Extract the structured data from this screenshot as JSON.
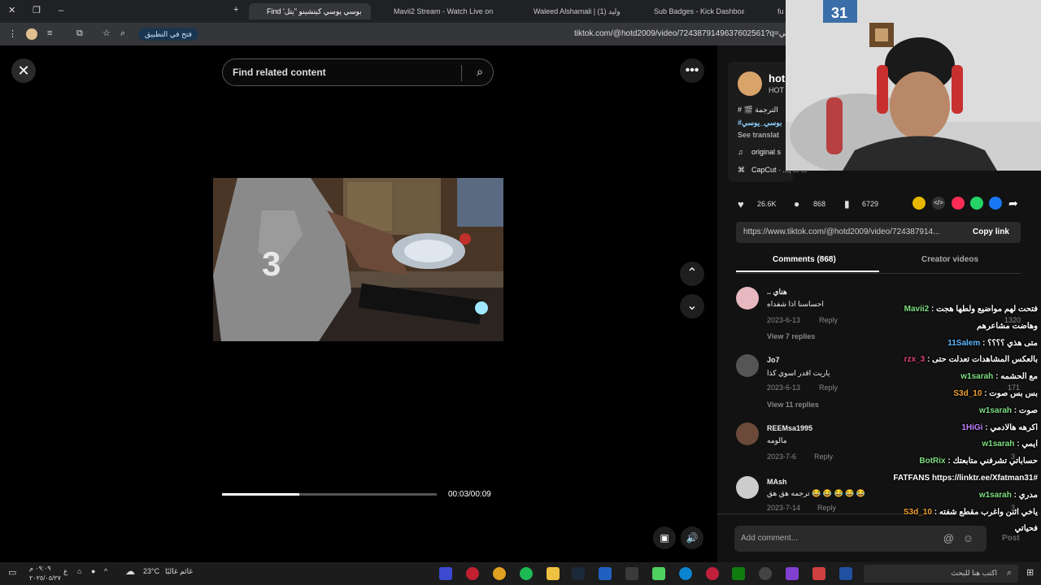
{
  "tabs": [
    {
      "label": "Find 'بوسي يوسي كيتشينو \"يتل"
    },
    {
      "label": "Mavii2 Stream - Watch Live on"
    },
    {
      "label": "Waleed Alshamali | (1) وليد"
    },
    {
      "label": "Sub Badges - Kick Dashboard"
    },
    {
      "label": "fu"
    }
  ],
  "address_bar": {
    "open_in_app": "فتح في التطبيق",
    "url": "tiktok.com/@hotd2009/video/7243879149637602561?q=يوسي"
  },
  "video": {
    "search_placeholder": "Find related content",
    "progress": 0.36,
    "time": "00:03/00:09"
  },
  "creator": {
    "name": "hot",
    "sub": "HOT",
    "caption_line1": "# 🎬 الترجمة",
    "caption_line2": "#بوسي_يوسي",
    "see_translation": "See translat",
    "sound": "original s",
    "capcut": "CapCut · ..., ... ..."
  },
  "stats": {
    "likes": "26.6K",
    "comments": "868",
    "saves": "6729"
  },
  "share": {
    "link": "https://www.tiktok.com/@hotd2009/video/724387914...",
    "copy_label": "Copy link"
  },
  "panel_tabs": {
    "comments": "Comments (868)",
    "creator_videos": "Creator videos"
  },
  "comments": [
    {
      "user": ".. هناي",
      "text": "احساسنا اذا شفداه",
      "date": "2023-6-13",
      "reply": "Reply",
      "replies": "View 7 replies",
      "likes": "1320"
    },
    {
      "user": "Jo7",
      "text": "ياريت اقدر اسوي كذا",
      "date": "2023-6-13",
      "reply": "Reply",
      "replies": "View 11 replies",
      "likes": "171"
    },
    {
      "user": "REEMsa1995",
      "text": "مالومه",
      "date": "2023-7-6",
      "reply": "Reply",
      "likes": "3"
    },
    {
      "user": "MAsh",
      "text": "ترجمه هق هق 😂 😂 😂 😂 😂",
      "date": "2023-7-14",
      "reply": "Reply",
      "likes": "3"
    }
  ],
  "add_comment": {
    "placeholder": "Add comment...",
    "post": "Post"
  },
  "chat": [
    {
      "name": "Mavii2",
      "msg": "فتحت لهم مواضيع ولطها هجت",
      "color": "#7ee081"
    },
    {
      "name": "",
      "msg": "وهاضت مشاعرهم",
      "color": "#fff"
    },
    {
      "name": "11Salem",
      "msg": "متى هذي ؟؟؟؟",
      "color": "#5fb8ff"
    },
    {
      "name": "rzx_3",
      "msg": "بالعكس المشاهدات تعدلت حتى",
      "color": "#e0407a"
    },
    {
      "name": "w1sarah",
      "msg": "مع الحشمه",
      "color": "#7ee081"
    },
    {
      "name": "S3d_10",
      "msg": "بس بس صوت",
      "color": "#f0a030"
    },
    {
      "name": "w1sarah",
      "msg": "صوت",
      "color": "#7ee081"
    },
    {
      "name": "1HiGi",
      "msg": "اكرهه هالادمي",
      "color": "#c080ff"
    },
    {
      "name": "w1sarah",
      "msg": "ايمي",
      "color": "#7ee081"
    },
    {
      "name": "BotRix",
      "msg": "حساباتي تشرفني متابعتك",
      "color": "#7ee081"
    },
    {
      "name": "",
      "msg": "#FATFANS https://linktr.ee/Xfatman31",
      "color": "#fff"
    },
    {
      "name": "w1sarah",
      "msg": "مدري",
      "color": "#7ee081"
    },
    {
      "name": "S3d_10",
      "msg": "ياخي اثنن واغرب مقطع شفته",
      "color": "#f0a030"
    },
    {
      "name": "",
      "msg": "فحياتي",
      "color": "#fff"
    }
  ],
  "taskbar": {
    "time": "٠٩:٠٩ م",
    "date": "٢٠٢٥/٠٥/٢٧",
    "weather_temp": "23°C",
    "weather_label": "غائم غالبًا",
    "search_placeholder": "اكتب هنا للبحث"
  },
  "colors": {
    "accent": "#fe2c55",
    "bg": "#121212"
  }
}
